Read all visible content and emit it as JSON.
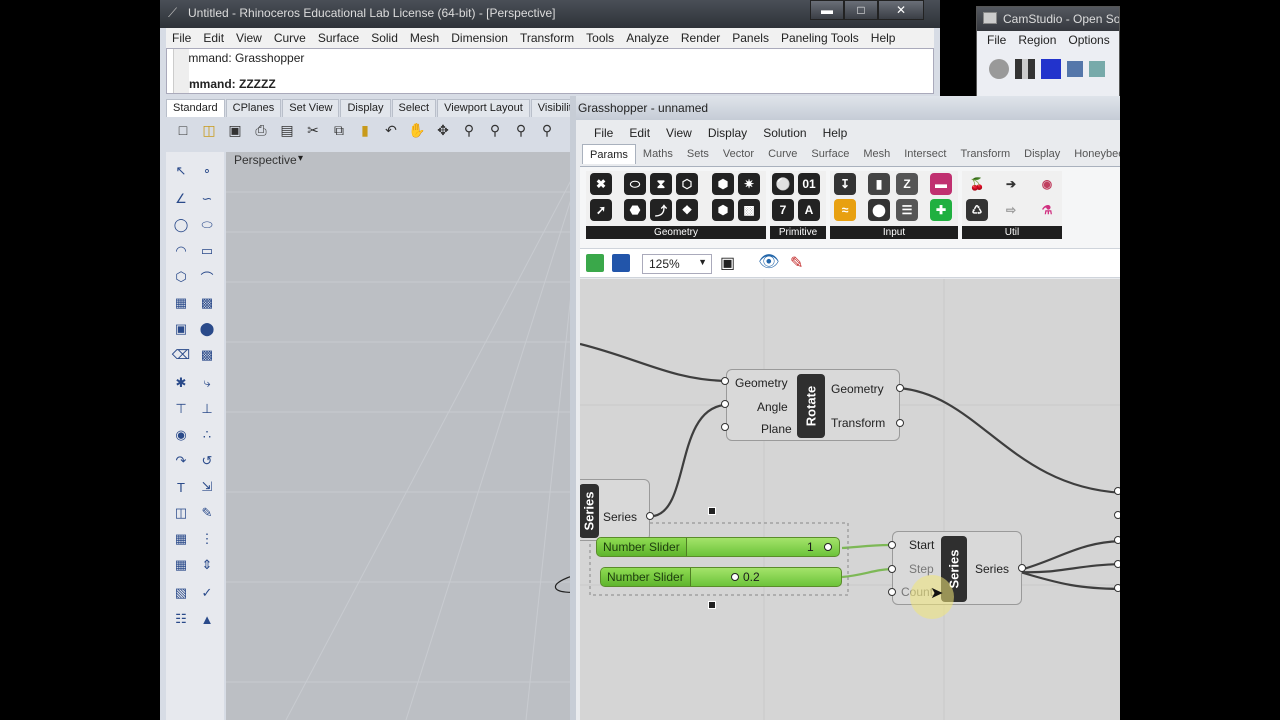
{
  "rhino": {
    "title": "Untitled - Rhinoceros Educational Lab License (64-bit) - [Perspective]",
    "menu": [
      "File",
      "Edit",
      "View",
      "Curve",
      "Surface",
      "Solid",
      "Mesh",
      "Dimension",
      "Transform",
      "Tools",
      "Analyze",
      "Render",
      "Panels",
      "Paneling Tools",
      "Help"
    ],
    "command_history": "Command: Grasshopper",
    "command_prompt": "Command: ZZZZZ",
    "toolbar_tabs": [
      "Standard",
      "CPlanes",
      "Set View",
      "Display",
      "Select",
      "Viewport Layout",
      "Visibility"
    ],
    "active_tab": "Standard",
    "viewport_label": "Perspective"
  },
  "camstudio": {
    "title": "CamStudio - Open Source",
    "menu": [
      "File",
      "Region",
      "Options"
    ]
  },
  "grasshopper": {
    "title": "Grasshopper - unnamed",
    "menu": [
      "File",
      "Edit",
      "View",
      "Display",
      "Solution",
      "Help"
    ],
    "component_tabs": [
      "Params",
      "Maths",
      "Sets",
      "Vector",
      "Curve",
      "Surface",
      "Mesh",
      "Intersect",
      "Transform",
      "Display",
      "Honeybee"
    ],
    "active_tab": "Params",
    "ribbon_groups": [
      "Geometry",
      "Primitive",
      "Input",
      "Util"
    ],
    "zoom": "125%",
    "components": {
      "rotate": {
        "name": "Rotate",
        "inputs": [
          "Geometry",
          "Angle",
          "Plane"
        ],
        "outputs": [
          "Geometry",
          "Transform"
        ]
      },
      "series_left": {
        "name": "Series",
        "output": "Series"
      },
      "series_right": {
        "name": "Series",
        "inputs": [
          "Start",
          "Step",
          "Count"
        ],
        "output": "Series"
      },
      "sliders": [
        {
          "label": "Number Slider",
          "value": "1",
          "fraction": 0.95
        },
        {
          "label": "Number Slider",
          "value": "0.2",
          "fraction": 0.25
        }
      ]
    }
  },
  "colors": {
    "rhino_bg": "#d7dce5",
    "gh_canvas": "#d5d5d5",
    "slider_green": "#7ccd45",
    "component_core": "#2f2f2f",
    "x_axis": "#b02020",
    "y_axis": "#2a9a2a"
  }
}
